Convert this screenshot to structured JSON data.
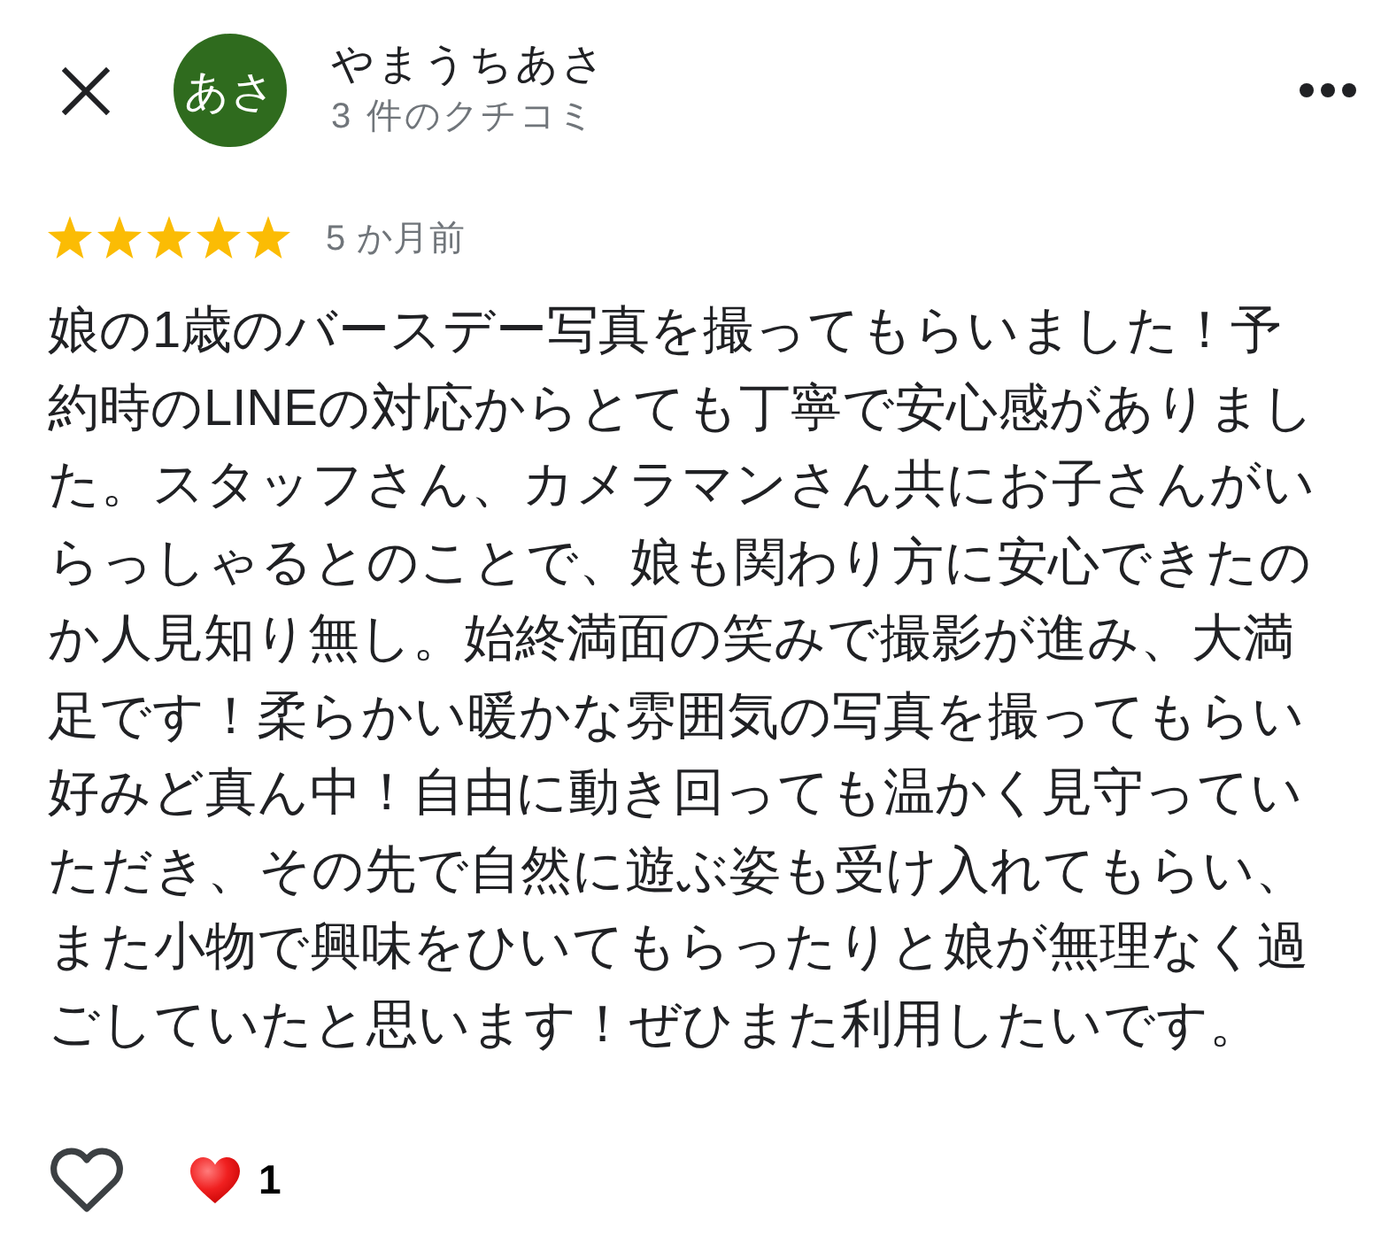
{
  "reviewer": {
    "avatar_text": "あさ",
    "name": "やまうちあさ",
    "review_count": "3 件のクチコミ"
  },
  "review": {
    "stars": 5,
    "time": "5 か月前",
    "text": "娘の1歳のバースデー写真を撮ってもらいました！予約時のLINEの対応からとても丁寧で安心感がありました。スタッフさん、カメラマンさん共にお子さんがいらっしゃるとのことで、娘も関わり方に安心できたのか人見知り無し。始終満面の笑みで撮影が進み、大満足です！柔らかい暖かな雰囲気の写真を撮ってもらい好みど真ん中！自由に動き回っても温かく見守っていただき、その先で自然に遊ぶ姿も受け入れてもらい、また小物で興味をひいてもらったりと娘が無理なく過ごしていたと思います！ぜひまた利用したいです。"
  },
  "reactions": {
    "liked": false,
    "count": "1"
  }
}
